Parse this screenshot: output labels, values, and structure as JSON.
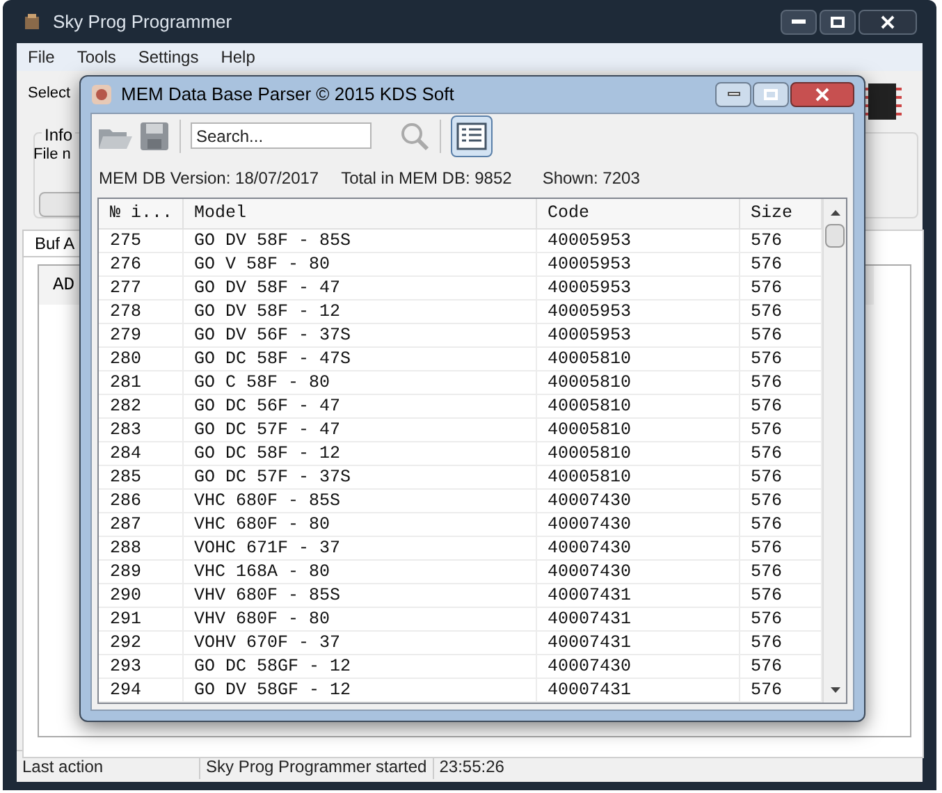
{
  "main_window": {
    "title": "Sky Prog Programmer",
    "menu": [
      "File",
      "Tools",
      "Settings",
      "Help"
    ],
    "selected_label": "Select",
    "info_group": "Info",
    "file_label": "File n",
    "buffer_tab": "Buf A",
    "buffer_header": "AD"
  },
  "dialog": {
    "title": "MEM Data Base Parser © 2015 KDS Soft",
    "search": {
      "placeholder": "Search..."
    },
    "list_view": {
      "selected": true
    },
    "info": {
      "version": "MEM DB Version: 18/07/2017",
      "total": "Total in MEM DB: 9852",
      "shown": "Shown: 7203"
    },
    "table": {
      "columns": [
        "№ i...",
        "Model",
        "Code",
        "Size"
      ],
      "rows": [
        [
          "275",
          "GO DV 58F - 85S",
          "40005953",
          "576"
        ],
        [
          "276",
          "GO V 58F - 80",
          "40005953",
          "576"
        ],
        [
          "277",
          "GO DV 58F - 47",
          "40005953",
          "576"
        ],
        [
          "278",
          "GO DV 58F - 12",
          "40005953",
          "576"
        ],
        [
          "279",
          "GO DV 56F - 37S",
          "40005953",
          "576"
        ],
        [
          "280",
          "GO DC 58F - 47S",
          "40005810",
          "576"
        ],
        [
          "281",
          "GO C 58F - 80",
          "40005810",
          "576"
        ],
        [
          "282",
          "GO DC 56F - 47",
          "40005810",
          "576"
        ],
        [
          "283",
          "GO DC 57F - 47",
          "40005810",
          "576"
        ],
        [
          "284",
          "GO DC 58F - 12",
          "40005810",
          "576"
        ],
        [
          "285",
          "GO DC 57F - 37S",
          "40005810",
          "576"
        ],
        [
          "286",
          "VHC 680F - 85S",
          "40007430",
          "576"
        ],
        [
          "287",
          "VHC 680F - 80",
          "40007430",
          "576"
        ],
        [
          "288",
          "VOHC 671F - 37",
          "40007430",
          "576"
        ],
        [
          "289",
          "VHC 168A - 80",
          "40007430",
          "576"
        ],
        [
          "290",
          "VHV 680F - 85S",
          "40007431",
          "576"
        ],
        [
          "291",
          "VHV 680F - 80",
          "40007431",
          "576"
        ],
        [
          "292",
          "VOHV 670F - 37",
          "40007431",
          "576"
        ],
        [
          "293",
          "GO DC 58GF - 12",
          "40007430",
          "576"
        ],
        [
          "294",
          "GO DV 58GF - 12",
          "40007431",
          "576"
        ]
      ]
    }
  },
  "status_bar": [
    "Last action",
    "Sky Prog Programmer started",
    "23:55:26"
  ]
}
